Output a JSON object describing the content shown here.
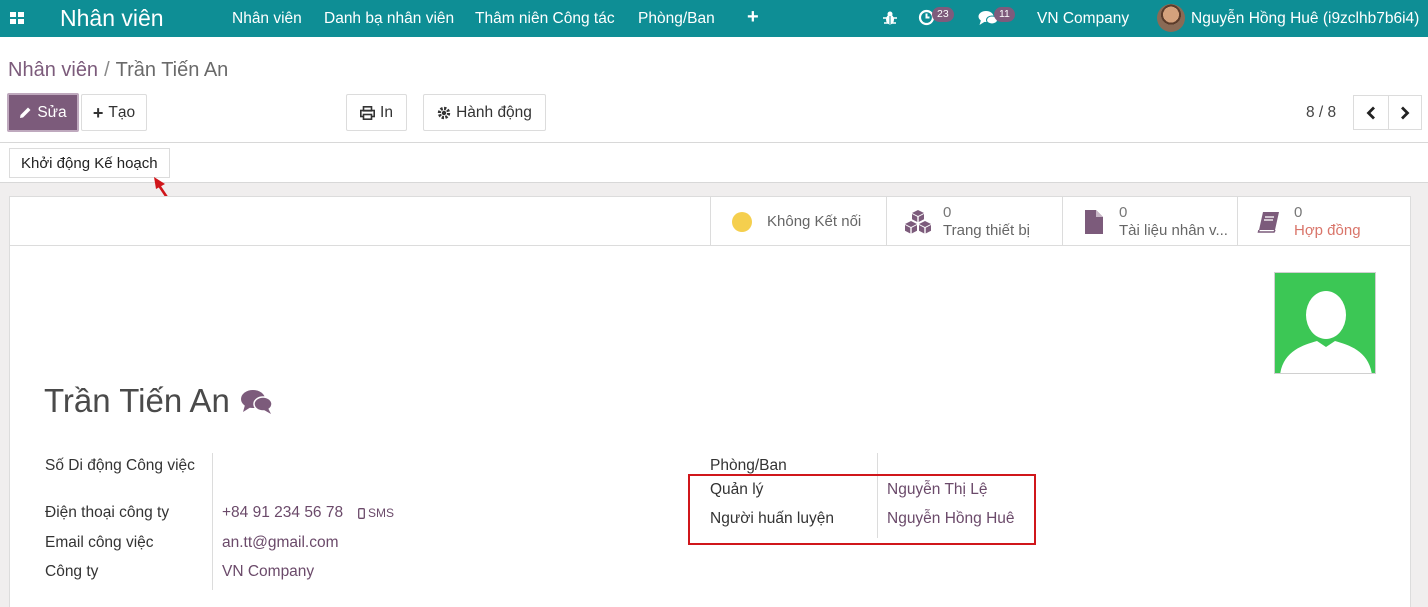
{
  "navbar": {
    "brand": "Nhân viên",
    "menu": [
      "Nhân viên",
      "Danh bạ nhân viên",
      "Thâm niên Công tác",
      "Phòng/Ban"
    ],
    "activity_count": "23",
    "message_count": "11",
    "company": "VN Company",
    "user": "Nguyễn Hồng Huê (i9zclhb7b6i4)"
  },
  "breadcrumb": {
    "parent": "Nhân viên",
    "separator": "/",
    "current": "Trần Tiến An"
  },
  "toolbar": {
    "edit_label": "Sửa",
    "create_label": "Tạo",
    "print_label": "In",
    "action_label": "Hành động"
  },
  "pager": {
    "value": "8 / 8"
  },
  "statusbar": {
    "plan_button": "Khởi động Kế hoạch"
  },
  "smart_buttons": {
    "presence": "Không Kết nối",
    "equipment": {
      "count": "0",
      "label": "Trang thiết bị"
    },
    "documents": {
      "count": "0",
      "label": "Tài liệu nhân v..."
    },
    "contracts": {
      "count": "0",
      "label": "Hợp đồng"
    }
  },
  "employee": {
    "name": "Trần Tiến An",
    "fields_left": {
      "mobile_label": "Số Di động Công việc",
      "phone_label": "Điện thoại công ty",
      "phone_value": "+84 91 234 56 78",
      "sms_label": "SMS",
      "email_label": "Email công việc",
      "email_value": "an.tt@gmail.com",
      "company_label": "Công ty",
      "company_value": "VN Company"
    },
    "fields_right": {
      "department_label": "Phòng/Ban",
      "manager_label": "Quản lý",
      "manager_value": "Nguyễn Thị Lệ",
      "coach_label": "Người huấn luyện",
      "coach_value": "Nguyễn Hồng Huê"
    }
  },
  "colors": {
    "navbar": "#0e8e95",
    "primary": "#7c5b7b",
    "highlight": "#d0161b",
    "photo_bg": "#3cc755",
    "contract_label": "#d9756a"
  }
}
